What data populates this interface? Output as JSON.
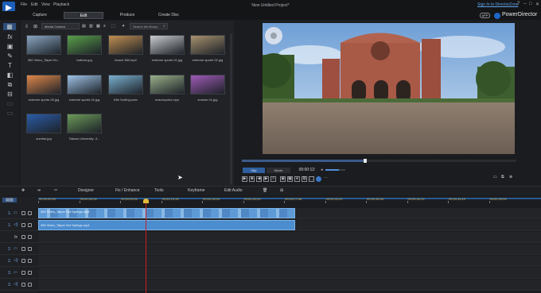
{
  "window": {
    "title": "New Untitled Project*",
    "menu": [
      "File",
      "Edit",
      "View",
      "Playback"
    ],
    "signin": "Sign In to DirectorZone",
    "brand": "PowerDirector",
    "app_badge": "APP",
    "controls": [
      "?",
      "–",
      "□",
      "✕"
    ]
  },
  "tabs": [
    "Capture",
    "Edit",
    "Produce",
    "Create Disc"
  ],
  "active_tab": "Edit",
  "library": {
    "filter": "Media Content",
    "search_placeholder": "Search the library",
    "items": [
      {
        "name": "360 Video_Taipei Ho...",
        "color": "#8aa6c2"
      },
      {
        "name": "balloon.jpg",
        "color": "#5a9f4a"
      },
      {
        "name": "beach 360.mp4",
        "color": "#c18f52"
      },
      {
        "name": "extreme sports 01.jpg",
        "color": "#c9ccd0"
      },
      {
        "name": "extreme sports 02.jpg",
        "color": "#a8926e"
      },
      {
        "name": "extreme sports 03.jpg",
        "color": "#e0884a"
      },
      {
        "name": "extreme sports 04.jpg",
        "color": "#9fc3e6"
      },
      {
        "name": "Kite Surfing.wmv",
        "color": "#7ab0cf"
      },
      {
        "name": "motorcycles.mpo",
        "color": "#9ab08a"
      },
      {
        "name": "sunrise 01.jpg",
        "color": "#a05ab8"
      },
      {
        "name": "sunrise.jpg",
        "color": "#2b5ca8"
      },
      {
        "name": "Taiwan University -3...",
        "color": "#6c9a5a"
      }
    ]
  },
  "preview": {
    "mode_clip": "Clip",
    "mode_movie": "Movie",
    "timecode": "00:00:12:"
  },
  "timeline_toolbar": [
    "Designer",
    "Fix / Enhance",
    "Tools",
    "Keyframe",
    "Edit Audio"
  ],
  "ruler": [
    "00;00;00;00",
    "00;00;04;16",
    "00;00;09;02",
    "00;00;13;18",
    "00;00;18;04",
    "00;00;22;20",
    "00;00;27;06",
    "00;00;31;22",
    "00;00;36;08",
    "00;00;40;24",
    "00;00;45;10",
    "00;00;49;26"
  ],
  "tracks": [
    {
      "label": "1.",
      "kind": "video",
      "clip": "360 Video_Taipei Hot Springs.mp4"
    },
    {
      "label": "1.",
      "kind": "audio",
      "clip": "360 Video_Taipei Hot Springs.mp4"
    },
    {
      "label": "fx",
      "kind": "fx",
      "clip": ""
    },
    {
      "label": "2.",
      "kind": "video",
      "clip": ""
    },
    {
      "label": "2.",
      "kind": "audio",
      "clip": ""
    },
    {
      "label": "3.",
      "kind": "video",
      "clip": ""
    },
    {
      "label": "3.",
      "kind": "audio",
      "clip": ""
    }
  ]
}
